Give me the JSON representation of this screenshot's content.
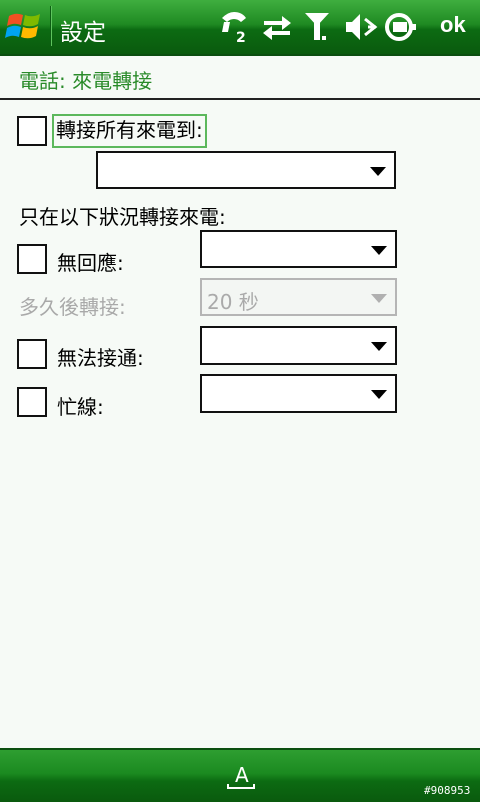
{
  "top_bar": {
    "title": "設定",
    "ok_label": "ok",
    "icons": [
      "windows-start-icon",
      "phone-line-2-icon",
      "data-sync-icon",
      "signal-icon",
      "speaker-muted-icon",
      "battery-charging-icon"
    ],
    "line_number": "2"
  },
  "page": {
    "title": "電話: 來電轉接"
  },
  "form": {
    "forward_all": {
      "label": "轉接所有來電到:",
      "checked": false,
      "value": ""
    },
    "section_label": "只在以下狀況轉接來電:",
    "no_answer": {
      "label": "無回應:",
      "checked": false,
      "value": ""
    },
    "delay": {
      "label": "多久後轉接:",
      "value": "20 秒",
      "disabled": true
    },
    "unavailable": {
      "label": "無法接通:",
      "checked": false,
      "value": ""
    },
    "busy": {
      "label": "忙線:",
      "checked": false,
      "value": ""
    }
  },
  "bottom_bar": {
    "ime_label": "A",
    "watermark": "#908953"
  },
  "colors": {
    "bar_green": "#1f8a22",
    "title_green": "#2a8b2a",
    "focus_green": "#5cb85c",
    "background": "#f6faf6"
  }
}
